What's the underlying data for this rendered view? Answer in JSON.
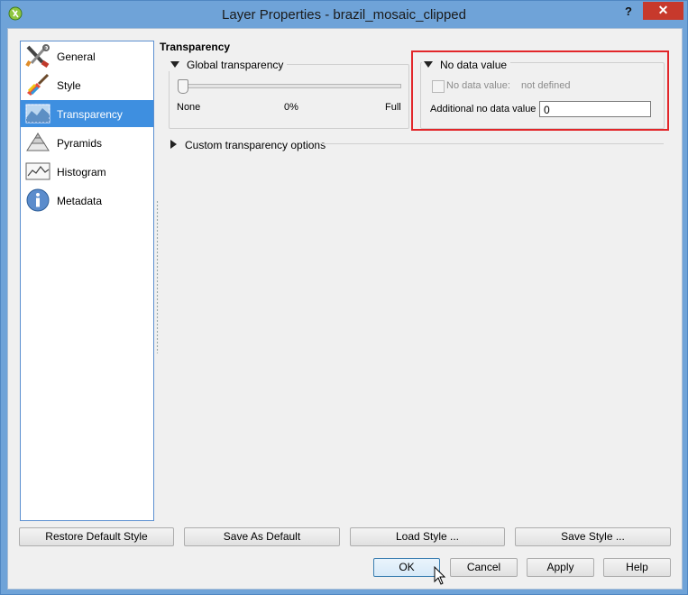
{
  "window": {
    "title": "Layer Properties - brazil_mosaic_clipped",
    "help_label": "?",
    "close_label": "✕"
  },
  "sidebar": {
    "items": [
      {
        "label": "General",
        "icon": "tools-icon"
      },
      {
        "label": "Style",
        "icon": "paintbrush-icon"
      },
      {
        "label": "Transparency",
        "icon": "transparency-icon",
        "active": true
      },
      {
        "label": "Pyramids",
        "icon": "pyramids-icon"
      },
      {
        "label": "Histogram",
        "icon": "histogram-icon"
      },
      {
        "label": "Metadata",
        "icon": "info-icon"
      }
    ]
  },
  "transparency": {
    "section_title": "Transparency",
    "global": {
      "header": "Global transparency",
      "min_label": "None",
      "value_label": "0%",
      "max_label": "Full",
      "value": 0
    },
    "nodata": {
      "header": "No data value",
      "checkbox_label": "No data value:",
      "checkbox_value": "not defined",
      "additional_label": "Additional no data value",
      "additional_value": "0"
    },
    "custom_header": "Custom transparency options"
  },
  "buttons": {
    "restore_default_style": "Restore Default Style",
    "save_as_default": "Save As Default",
    "load_style": "Load Style ...",
    "save_style": "Save Style ...",
    "ok": "OK",
    "cancel": "Cancel",
    "apply": "Apply",
    "help": "Help"
  },
  "colors": {
    "active_item": "#3e8fe0",
    "highlight": "#e2262a",
    "close": "#c7392c"
  }
}
